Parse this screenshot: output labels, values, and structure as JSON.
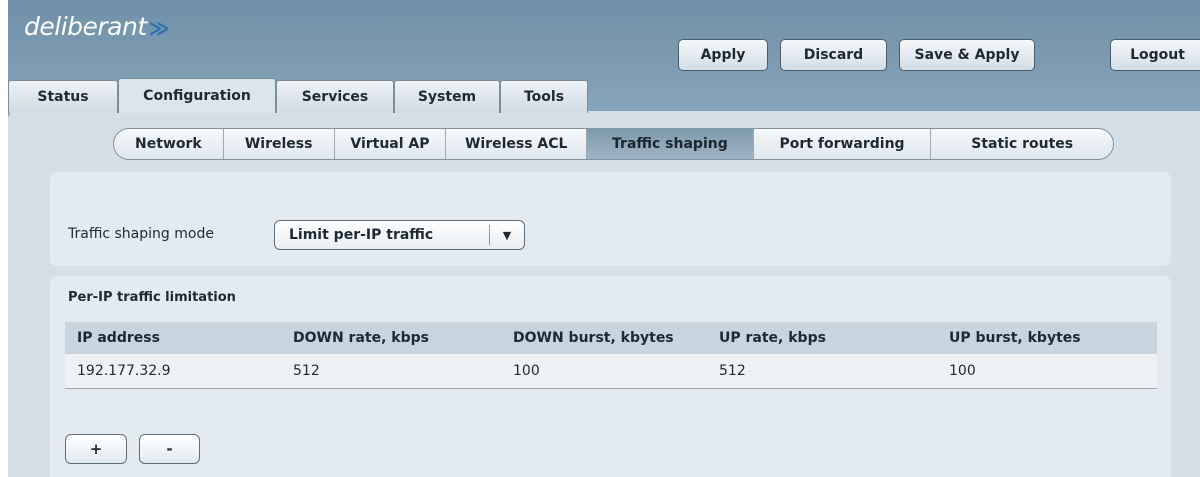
{
  "brand": {
    "logo_text": "deliberant",
    "logo_mark": "≫"
  },
  "toolbar": {
    "apply": "Apply",
    "discard": "Discard",
    "save_apply": "Save & Apply",
    "logout": "Logout"
  },
  "tabs": [
    {
      "label": "Status"
    },
    {
      "label": "Configuration",
      "active": true
    },
    {
      "label": "Services"
    },
    {
      "label": "System"
    },
    {
      "label": "Tools"
    }
  ],
  "subtabs": [
    {
      "label": "Network"
    },
    {
      "label": "Wireless"
    },
    {
      "label": "Virtual AP"
    },
    {
      "label": "Wireless ACL"
    },
    {
      "label": "Traffic shaping",
      "active": true
    },
    {
      "label": "Port forwarding"
    },
    {
      "label": "Static routes"
    }
  ],
  "mode": {
    "label": "Traffic shaping mode",
    "selected": "Limit per-IP traffic",
    "arrow": "▼"
  },
  "limits": {
    "title": "Per-IP traffic limitation",
    "columns": [
      "IP address",
      "DOWN rate, kbps",
      "DOWN burst, kbytes",
      "UP rate, kbps",
      "UP burst, kbytes"
    ],
    "rows": [
      [
        "192.177.32.9",
        "512",
        "100",
        "512",
        "100"
      ]
    ],
    "add_label": "+",
    "remove_label": "-"
  }
}
